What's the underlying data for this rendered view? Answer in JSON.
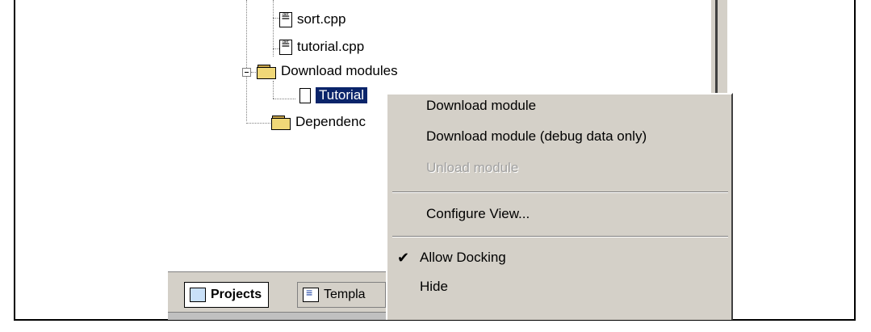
{
  "tree": {
    "items": [
      {
        "label": "sort.cpp"
      },
      {
        "label": "tutorial.cpp"
      },
      {
        "label": "Download modules"
      },
      {
        "label": "Tutorial"
      },
      {
        "label": "Dependenc"
      }
    ]
  },
  "tabs": [
    {
      "label": "Projects"
    },
    {
      "label": "Templa"
    }
  ],
  "context_menu": {
    "items": [
      {
        "label": "Download module"
      },
      {
        "label": "Download module (debug data only)"
      },
      {
        "label": "Unload module",
        "disabled": true
      },
      {
        "label": "Configure View..."
      },
      {
        "label": "Allow Docking",
        "checked": true
      },
      {
        "label": "Hide"
      }
    ],
    "check_glyph": "✔"
  }
}
